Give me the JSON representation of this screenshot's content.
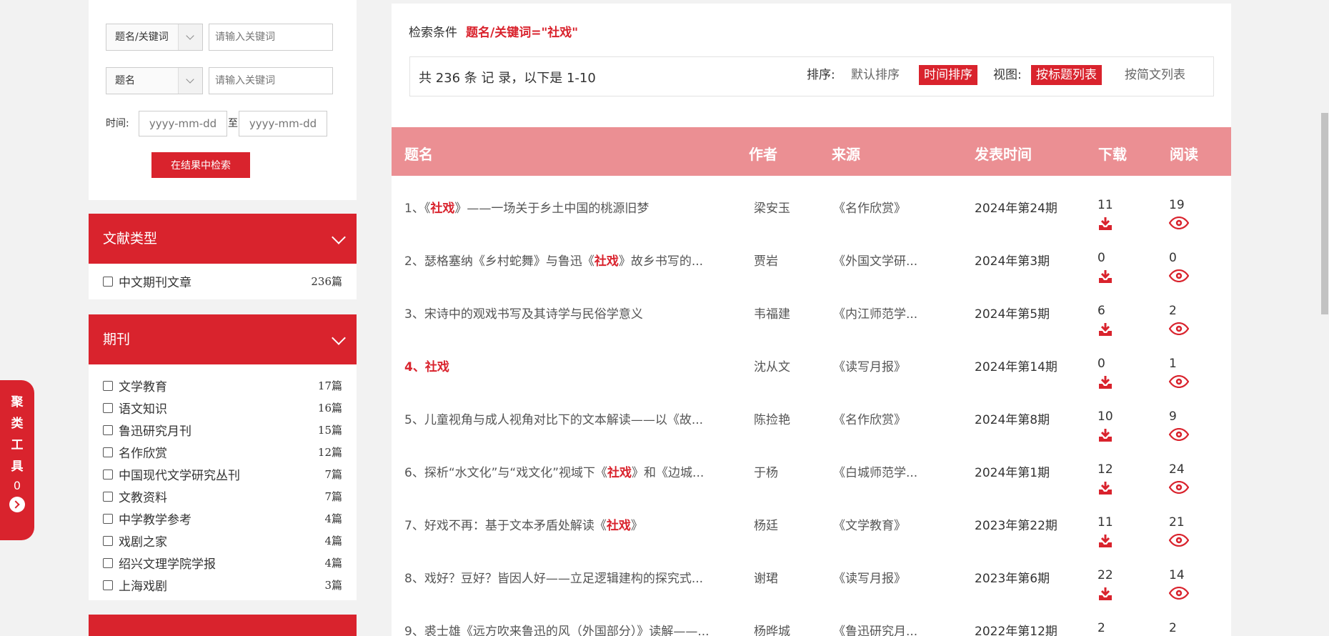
{
  "search": {
    "field1": "题名/关键词",
    "field2": "题名",
    "kw_placeholder": "请输入关键词",
    "time_label": "时间:",
    "date_placeholder": "yyyy-mm-dd",
    "to_label": "至",
    "button": "在结果中检索"
  },
  "facets": [
    {
      "title": "文献类型",
      "items": [
        {
          "label": "中文期刊文章",
          "count": "236篇"
        }
      ]
    },
    {
      "title": "期刊",
      "items": [
        {
          "label": "文学教育",
          "count": "17篇"
        },
        {
          "label": "语文知识",
          "count": "16篇"
        },
        {
          "label": "鲁迅研究月刊",
          "count": "15篇"
        },
        {
          "label": "名作欣赏",
          "count": "12篇"
        },
        {
          "label": "中国现代文学研究丛刊",
          "count": "7篇"
        },
        {
          "label": "文教资料",
          "count": "7篇"
        },
        {
          "label": "中学教学参考",
          "count": "4篇"
        },
        {
          "label": "戏剧之家",
          "count": "4篇"
        },
        {
          "label": "绍兴文理学院学报",
          "count": "4篇"
        },
        {
          "label": "上海戏剧",
          "count": "3篇"
        }
      ]
    }
  ],
  "cluster": {
    "chars": [
      "聚",
      "类",
      "工",
      "具"
    ],
    "count": "0"
  },
  "condition": {
    "label": "检索条件",
    "value": "题名/关键词=\"社戏\""
  },
  "summary": {
    "total": "共 236 条 记 录，以下是 1-10",
    "sort_label": "排序:",
    "sort_default": "默认排序",
    "sort_time": "时间排序",
    "view_label": "视图:",
    "view_title": "按标题列表",
    "view_brief": "按简文列表"
  },
  "table": {
    "headers": {
      "title": "题名",
      "author": "作者",
      "source": "来源",
      "date": "发表时间",
      "download": "下载",
      "read": "阅读"
    },
    "rows": [
      {
        "pre": "1、《",
        "hl": "社戏",
        "post": "》——一场关于乡土中国的桃源旧梦",
        "author": "梁安玉",
        "source": "《名作欣赏》",
        "date": "2024年第24期",
        "download": "11",
        "read": "19"
      },
      {
        "pre": "2、瑟格塞纳《乡村蛇舞》与鲁迅《",
        "hl": "社戏",
        "post": "》故乡书写的...",
        "author": "贾岩",
        "source": "《外国文学研...",
        "date": "2024年第3期",
        "download": "0",
        "read": "0"
      },
      {
        "pre": "3、宋诗中的观戏书写及其诗学与民俗学意义",
        "hl": "",
        "post": "",
        "author": "韦福建",
        "source": "《内江师范学...",
        "date": "2024年第5期",
        "download": "6",
        "read": "2"
      },
      {
        "pre": "4、",
        "hl": "社戏",
        "post": "",
        "author": "沈从文",
        "source": "《读写月报》",
        "date": "2024年第14期",
        "download": "0",
        "read": "1"
      },
      {
        "pre": "5、儿童视角与成人视角对比下的文本解读——以《故...",
        "hl": "",
        "post": "",
        "author": "陈捡艳",
        "source": "《名作欣赏》",
        "date": "2024年第8期",
        "download": "10",
        "read": "9"
      },
      {
        "pre": "6、探析“水文化”与“戏文化”视域下《",
        "hl": "社戏",
        "post": "》和《边城...",
        "author": "于杨",
        "source": "《白城师范学...",
        "date": "2024年第1期",
        "download": "12",
        "read": "24"
      },
      {
        "pre": "7、好戏不再：基于文本矛盾处解读《",
        "hl": "社戏",
        "post": "》",
        "author": "杨廷",
        "source": "《文学教育》",
        "date": "2023年第22期",
        "download": "11",
        "read": "21"
      },
      {
        "pre": "8、戏好？豆好？皆因人好——立足逻辑建构的探究式...",
        "hl": "",
        "post": "",
        "author": "谢珺",
        "source": "《读写月报》",
        "date": "2023年第6期",
        "download": "22",
        "read": "14"
      },
      {
        "pre": "9、裘士雄《远方吹来鲁迅的风（外国部分）》读解——...",
        "hl": "",
        "post": "",
        "author": "杨晔城",
        "source": "《鲁迅研究月...",
        "date": "2022年第12期",
        "download": "2",
        "read": "2"
      }
    ]
  },
  "colors": {
    "accent": "#d9232d",
    "header": "#eb8f93"
  }
}
